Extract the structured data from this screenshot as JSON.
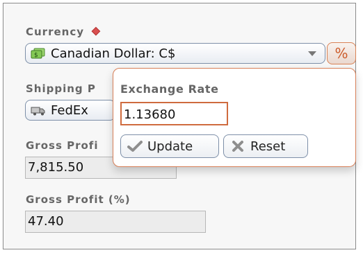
{
  "currency": {
    "label": "Currency",
    "selected": "Canadian Dollar: C$",
    "percent_button": "%"
  },
  "shipping": {
    "label": "Shipping P",
    "selected": "FedEx"
  },
  "gross_profit": {
    "label": "Gross Profi",
    "value": "7,815.50"
  },
  "gross_profit_percent": {
    "label": "Gross Profit (%)",
    "value": "47.40"
  },
  "exchange_rate": {
    "label": "Exchange Rate",
    "value": "1.13680",
    "update_button": "Update",
    "reset_button": "Reset"
  },
  "colors": {
    "accent": "#cf6b3e",
    "border": "#7d8fa8",
    "required_marker": "#d94f4f"
  },
  "icons": {
    "currency": "currency-icon",
    "shipping": "truck-icon",
    "update": "check-icon",
    "reset": "x-icon"
  }
}
